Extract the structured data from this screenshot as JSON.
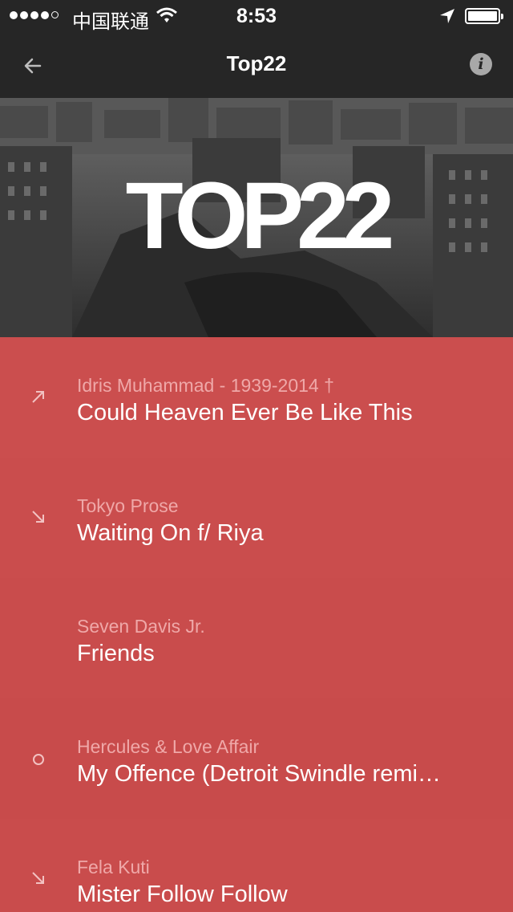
{
  "status_bar": {
    "carrier": "中国联通",
    "time": "8:53"
  },
  "nav": {
    "title": "Top22",
    "back_icon": "arrow-left-icon",
    "info_icon": "info-icon"
  },
  "hero": {
    "logo_text": "TOP22"
  },
  "tracks": [
    {
      "artist": "Idris Muhammad - 1939-2014 †",
      "title": "Could Heaven Ever Be Like This",
      "trend": "up"
    },
    {
      "artist": "Tokyo Prose",
      "title": "Waiting On f/ Riya",
      "trend": "down"
    },
    {
      "artist": "Seven Davis Jr.",
      "title": "Friends",
      "trend": "none"
    },
    {
      "artist": "Hercules & Love Affair",
      "title": "My Offence (Detroit Swindle remi…",
      "trend": "new"
    },
    {
      "artist": "Fela Kuti",
      "title": "Mister Follow Follow",
      "trend": "down"
    }
  ],
  "colors": {
    "list_bg": "#cb4e4e",
    "bar_bg": "#262626"
  }
}
